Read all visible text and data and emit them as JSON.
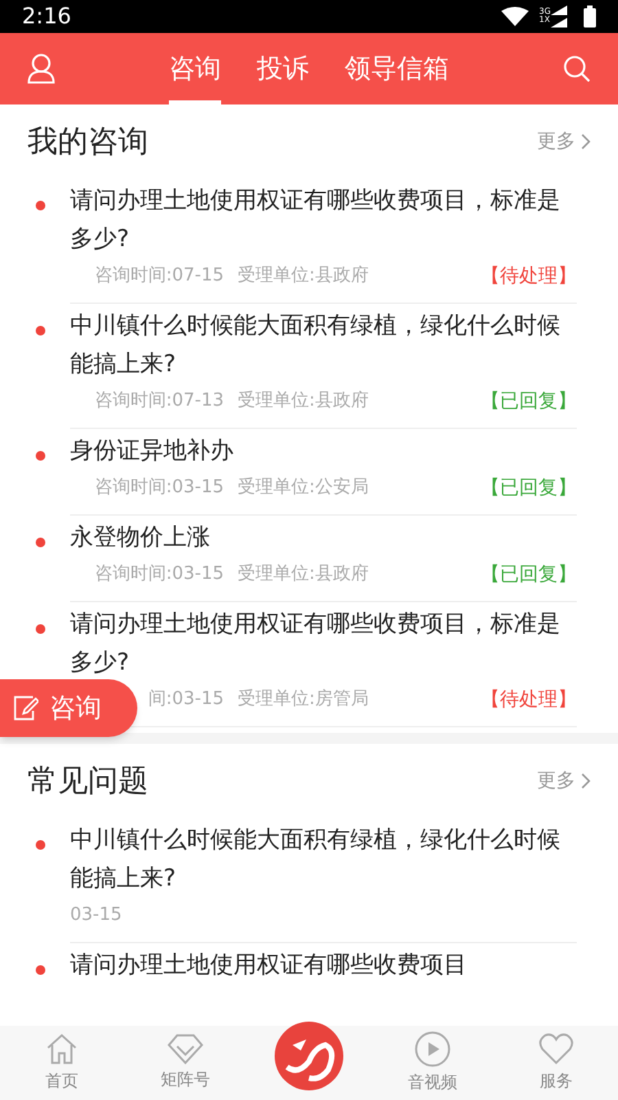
{
  "status_bar": {
    "time": "2:16",
    "network_labels": [
      "3G",
      "1X"
    ]
  },
  "header": {
    "tabs": [
      {
        "label": "咨询",
        "selected": true
      },
      {
        "label": "投诉",
        "selected": false
      },
      {
        "label": "领导信箱",
        "selected": false
      }
    ]
  },
  "my_consultations": {
    "title": "我的咨询",
    "more": "更多",
    "items": [
      {
        "question": "请问办理土地使用权证有哪些收费项目，标准是多少?",
        "time": "咨询时间:07-15",
        "unit": "受理单位:县政府",
        "status": "【待处理】",
        "kind": "pending"
      },
      {
        "question": "中川镇什么时候能大面积有绿植，绿化什么时候能搞上来?",
        "time": "咨询时间:07-13",
        "unit": "受理单位:县政府",
        "status": "【已回复】",
        "kind": "replied"
      },
      {
        "question": "身份证异地补办",
        "time": "咨询时间:03-15",
        "unit": "受理单位:公安局",
        "status": "【已回复】",
        "kind": "replied"
      },
      {
        "question": "永登物价上涨",
        "time": "咨询时间:03-15",
        "unit": "受理单位:县政府",
        "status": "【已回复】",
        "kind": "replied"
      },
      {
        "question": "请问办理土地使用权证有哪些收费项目，标准是多少?",
        "time": "间:03-15",
        "unit": "受理单位:房管局",
        "status": "【待处理】",
        "kind": "pending"
      }
    ]
  },
  "floating_button": {
    "label": "咨询"
  },
  "faq": {
    "title": "常见问题",
    "more": "更多",
    "items": [
      {
        "question": "中川镇什么时候能大面积有绿植，绿化什么时候能搞上来?",
        "date": "03-15"
      },
      {
        "question": "请问办理土地使用权证有哪些收费项目"
      }
    ]
  },
  "bottom_nav": [
    {
      "label": "首页",
      "kind": "home"
    },
    {
      "label": "矩阵号",
      "kind": "matrix"
    },
    {
      "kind": "logo"
    },
    {
      "label": "音视频",
      "kind": "video"
    },
    {
      "label": "服务",
      "kind": "service"
    }
  ]
}
